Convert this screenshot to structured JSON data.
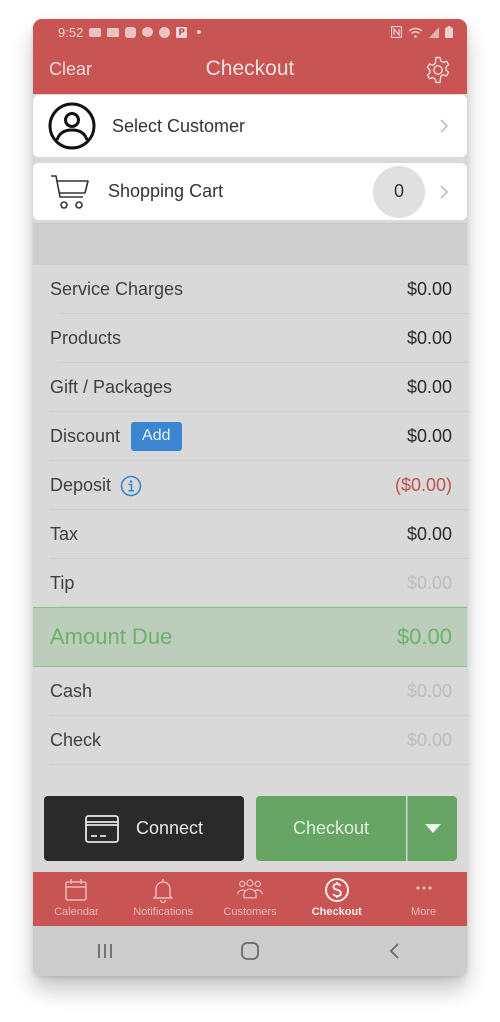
{
  "status_bar": {
    "time": "9:52",
    "notification_icons": [
      "message-icon",
      "cnn-icon",
      "person-chat-icon",
      "cat-icon",
      "fandango-icon",
      "parking-icon",
      "dot-icon"
    ],
    "parking_letter": "P",
    "right_icons": [
      "nfc-icon",
      "wifi-icon",
      "signal-icon",
      "battery-icon"
    ]
  },
  "header": {
    "clear_label": "Clear",
    "title": "Checkout",
    "settings_icon": "gear-icon"
  },
  "customer": {
    "label": "Select Customer",
    "icon": "user-circle-icon"
  },
  "cart": {
    "label": "Shopping Cart",
    "count": "0",
    "icon": "shopping-cart-icon"
  },
  "summary": {
    "rows": [
      {
        "label": "Service Charges",
        "value": "$0.00"
      },
      {
        "label": "Products",
        "value": "$0.00"
      },
      {
        "label": "Gift / Packages",
        "value": "$0.00"
      },
      {
        "label": "Discount",
        "value": "$0.00",
        "button": "Add"
      },
      {
        "label": "Deposit",
        "value": "($0.00)"
      },
      {
        "label": "Tax",
        "value": "$0.00"
      },
      {
        "label": "Tip",
        "value": "$0.00"
      }
    ],
    "amount_due": {
      "label": "Amount Due",
      "value": "$0.00"
    },
    "payments": [
      {
        "label": "Cash",
        "value": "$0.00"
      },
      {
        "label": "Check",
        "value": "$0.00"
      }
    ]
  },
  "actions": {
    "connect_label": "Connect",
    "checkout_label": "Checkout"
  },
  "tabbar": {
    "items": [
      {
        "label": "Calendar",
        "icon": "calendar-icon",
        "active": false
      },
      {
        "label": "Notifications",
        "icon": "bell-icon",
        "active": false
      },
      {
        "label": "Customers",
        "icon": "people-icon",
        "active": false
      },
      {
        "label": "Checkout",
        "icon": "dollar-circle-icon",
        "active": true
      },
      {
        "label": "More",
        "icon": "more-dots-icon",
        "active": false
      }
    ]
  },
  "colors": {
    "brand": "#c95454",
    "success": "#67a564",
    "link_blue": "#3a86d0",
    "negative": "#c0504d",
    "dark_button": "#2a2a2a"
  }
}
